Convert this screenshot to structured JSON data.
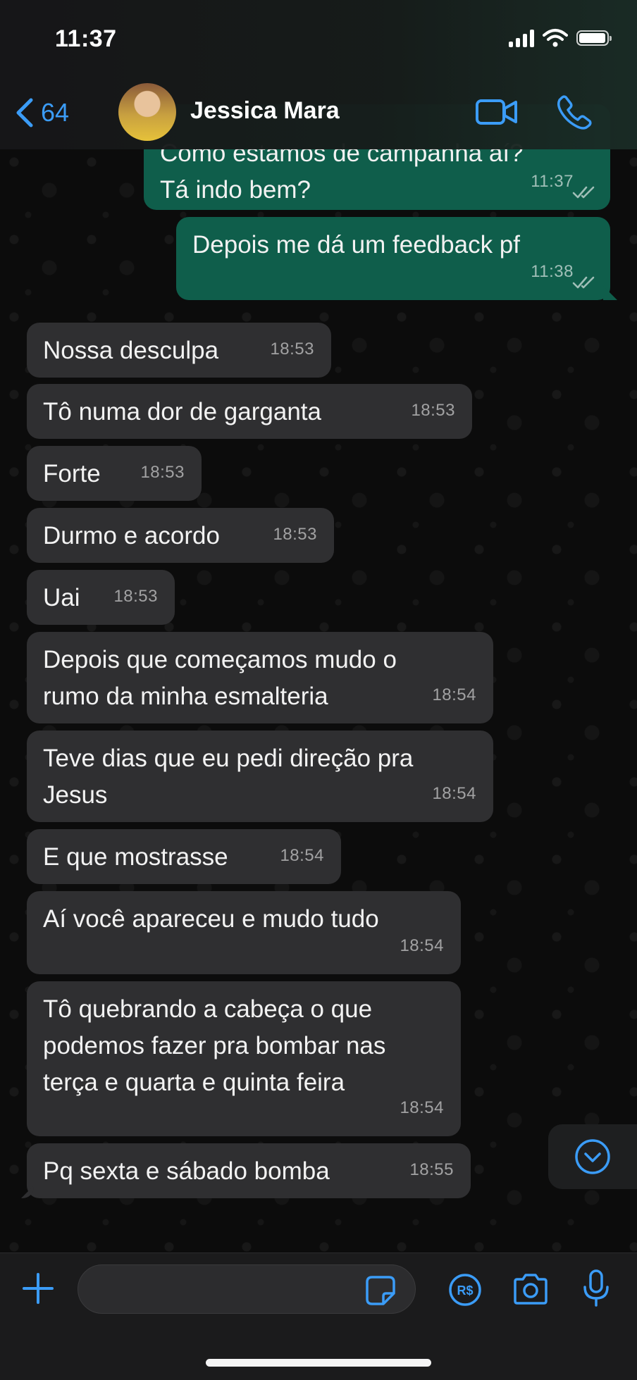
{
  "status_bar": {
    "time": "11:37"
  },
  "header": {
    "back_count": "64",
    "contact_name": "Jessica Mara"
  },
  "messages": [
    {
      "direction": "outgoing",
      "lines": [
        "Como estamos de campanha aí?",
        "Tá indo bem?"
      ],
      "time": "11:37",
      "status": "read"
    },
    {
      "direction": "outgoing",
      "lines": [
        "Depois me dá um feedback pf"
      ],
      "time": "11:38",
      "status": "read"
    },
    {
      "direction": "incoming",
      "lines": [
        "Nossa desculpa"
      ],
      "time": "18:53"
    },
    {
      "direction": "incoming",
      "lines": [
        "Tô numa dor de garganta"
      ],
      "time": "18:53"
    },
    {
      "direction": "incoming",
      "lines": [
        "Forte"
      ],
      "time": "18:53"
    },
    {
      "direction": "incoming",
      "lines": [
        "Durmo e acordo"
      ],
      "time": "18:53"
    },
    {
      "direction": "incoming",
      "lines": [
        "Uai"
      ],
      "time": "18:53"
    },
    {
      "direction": "incoming",
      "lines": [
        "Depois que começamos mudo o",
        "rumo da minha esmalteria"
      ],
      "time": "18:54"
    },
    {
      "direction": "incoming",
      "lines": [
        "Teve dias que eu pedi direção pra",
        "Jesus"
      ],
      "time": "18:54"
    },
    {
      "direction": "incoming",
      "lines": [
        "E que mostrasse"
      ],
      "time": "18:54"
    },
    {
      "direction": "incoming",
      "lines": [
        "Aí você apareceu e mudo tudo"
      ],
      "time": "18:54"
    },
    {
      "direction": "incoming",
      "lines": [
        "Tô quebrando a cabeça o que",
        "podemos fazer pra bombar nas",
        "terça e quarta e quinta feira"
      ],
      "time": "18:54"
    },
    {
      "direction": "incoming",
      "lines": [
        "Pq sexta e sábado bomba"
      ],
      "time": "18:55"
    }
  ],
  "composer": {
    "input_value": "",
    "icons": [
      "plus-icon",
      "sticker-icon",
      "payment-icon",
      "camera-icon",
      "microphone-icon"
    ]
  },
  "colors": {
    "accent": "#3b9cf7",
    "incoming_bubble": "#2f2f31",
    "outgoing_bubble": "#0f5e4b",
    "background": "#0c0c0c"
  }
}
